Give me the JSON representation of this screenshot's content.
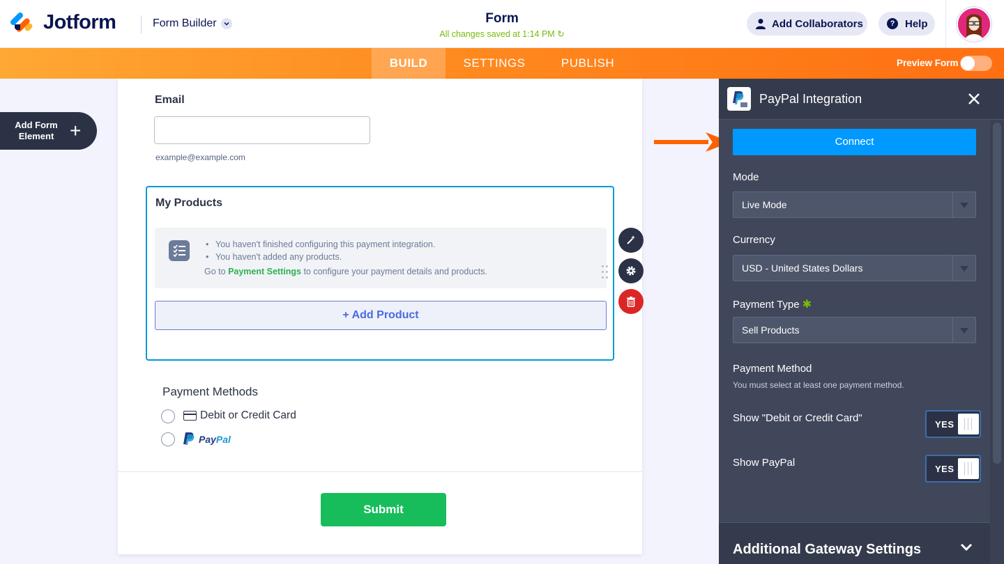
{
  "header": {
    "brand": "Jotform",
    "builder_label": "Form Builder",
    "form_title": "Form",
    "save_status": "All changes saved at 1:14 PM",
    "collaborators_label": "Add Collaborators",
    "help_label": "Help"
  },
  "nav": {
    "tabs": [
      {
        "label": "BUILD",
        "active": true
      },
      {
        "label": "SETTINGS",
        "active": false
      },
      {
        "label": "PUBLISH",
        "active": false
      }
    ],
    "preview_label": "Preview Form",
    "preview_on": false
  },
  "sidebar": {
    "add_element_label": "Add Form Element"
  },
  "form": {
    "email_label": "Email",
    "email_value": "",
    "email_sublabel": "example@example.com",
    "products_label": "My Products",
    "warning_line1": "You haven't finished configuring this payment integration.",
    "warning_line2": "You haven't added any products.",
    "warning_prefix": "Go to",
    "warning_link": "Payment Settings",
    "warning_suffix": "to configure your payment details and products.",
    "add_product_label": "+ Add Product",
    "payment_methods_label": "Payment Methods",
    "method_card": "Debit or Credit Card",
    "method_paypal_pay": "Pay",
    "method_paypal_pal": "Pal",
    "submit_label": "Submit"
  },
  "panel": {
    "title": "PayPal Integration",
    "connect_label": "Connect",
    "mode_label": "Mode",
    "mode_value": "Live Mode",
    "currency_label": "Currency",
    "currency_value": "USD - United States Dollars",
    "payment_type_label": "Payment Type",
    "payment_type_value": "Sell Products",
    "payment_method_label": "Payment Method",
    "payment_method_sub": "You must select at least one payment method.",
    "show_card_label": "Show \"Debit or Credit Card\"",
    "show_card_value": "YES",
    "show_paypal_label": "Show PayPal",
    "show_paypal_value": "YES",
    "gateway_settings_label": "Additional Gateway Settings"
  },
  "colors": {
    "brand_orange": "#ff6100",
    "connect_blue": "#0099ff",
    "submit_green": "#18bd5b",
    "panel_bg": "#40475a",
    "delete_red": "#dc2626"
  }
}
